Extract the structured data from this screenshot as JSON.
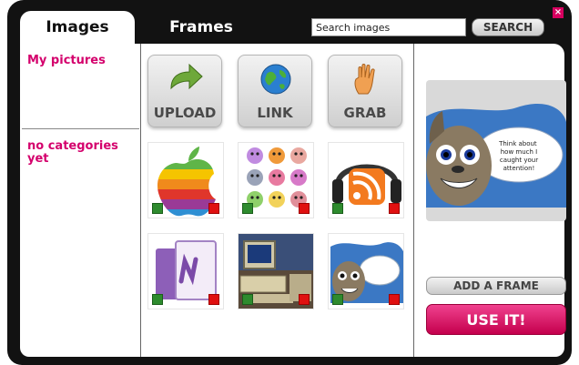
{
  "tabs": [
    {
      "label": "Images",
      "active": true
    },
    {
      "label": "Frames",
      "active": false
    }
  ],
  "search": {
    "value": "Search images",
    "button_label": "SEARCH"
  },
  "close_glyph": "×",
  "sidebar": {
    "my_pictures": "My pictures",
    "no_categories": "no categories yet"
  },
  "actions": [
    {
      "label": "UPLOAD",
      "icon": "green-arrow-icon"
    },
    {
      "label": "LINK",
      "icon": "globe-icon"
    },
    {
      "label": "GRAB",
      "icon": "hand-icon"
    }
  ],
  "thumbnails": [
    {
      "subject": "rainbow apple logo"
    },
    {
      "subject": "grid of emoticon faces"
    },
    {
      "subject": "rss feed headphones"
    },
    {
      "subject": "purple notebook"
    },
    {
      "subject": "old computer"
    },
    {
      "subject": "squirrel in frame"
    }
  ],
  "preview": {
    "caption": "Think about how much I caught your attention!"
  },
  "buttons": {
    "add_frame": "ADD A FRAME",
    "use_it": "USE IT!"
  },
  "colors": {
    "accent_pink": "#d4006c",
    "use_button": "#d8005f",
    "frame_dark": "#121212",
    "use_icon_green": "#2e8b2e",
    "delete_icon_red": "#e01010"
  }
}
